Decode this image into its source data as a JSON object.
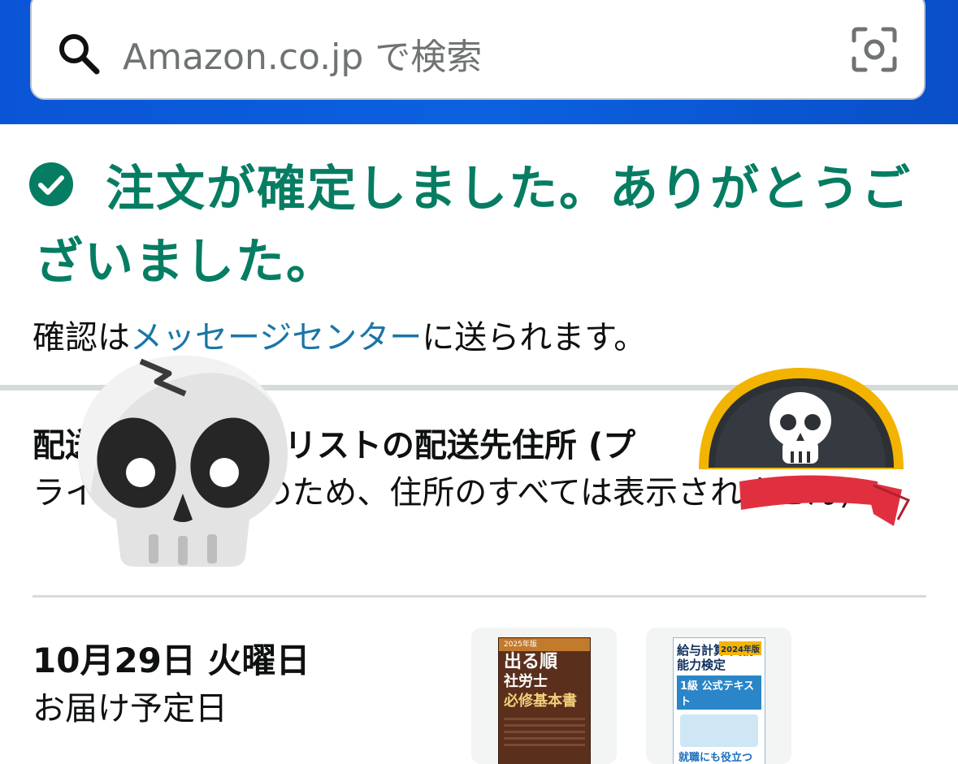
{
  "search": {
    "placeholder": "Amazon.co.jp で検索"
  },
  "confirmation": {
    "title": "注文が確定しました。ありがとうございました。",
    "sub_prefix": "確認は",
    "sub_link": "メッセージセンター",
    "sub_suffix": "に送られます。"
  },
  "address": {
    "title": "配送先: 欲しい物リストの配送先住所 (プ",
    "desc": "ライバシー保護のため、住所のすべては表示されません)"
  },
  "delivery": {
    "date": "10月29日 火曜日",
    "label": "お届け予定日"
  },
  "products": [
    {
      "year": "2025年版",
      "title1": "出る順",
      "title2": "社労士",
      "title3": "必修基本書"
    },
    {
      "badge": "2024年版",
      "title1": "給与計算 実務能力検定",
      "title2": "1級 公式テキスト",
      "title3": "就職にも役立つ 注目資格!"
    }
  ],
  "icons": [
    "search-icon",
    "camera-icon",
    "check-circle-icon",
    "skull-icon",
    "pirate-hat-icon"
  ],
  "colors": {
    "header_blue": "#0a55d6",
    "success_green": "#067d62",
    "link_blue": "#1a76a5"
  }
}
